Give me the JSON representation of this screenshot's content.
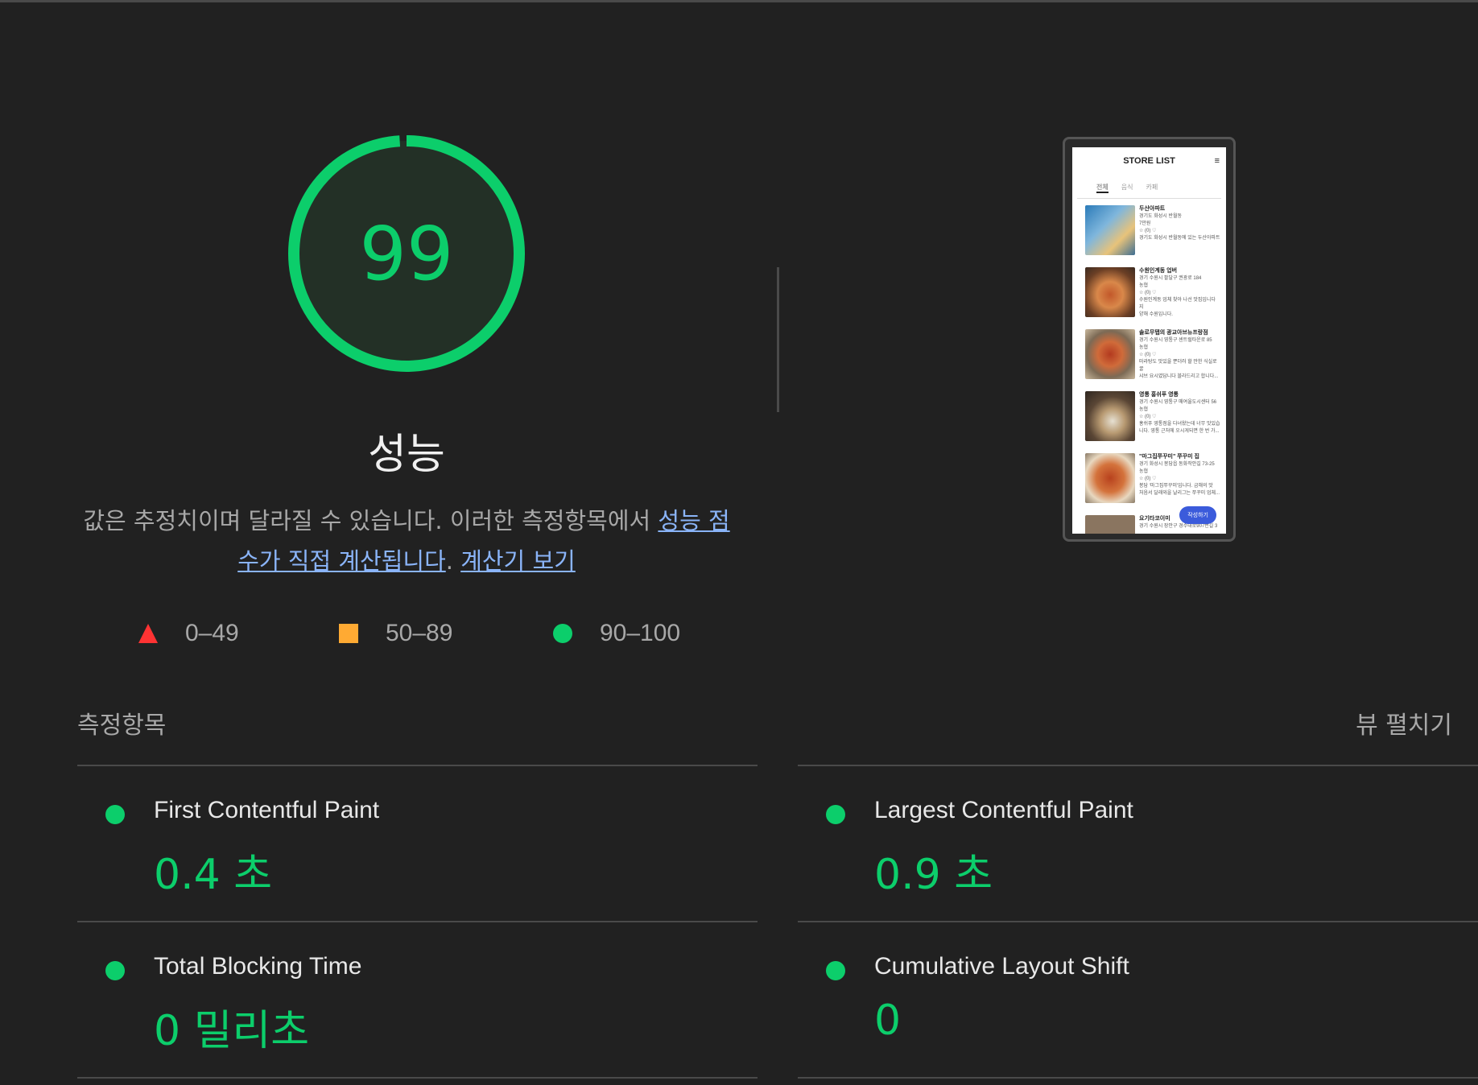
{
  "gauge": {
    "score": "99",
    "score_fraction": 0.99,
    "title": "성능",
    "color": "#0cce6b"
  },
  "description": {
    "text_before": "값은 추정치이며 달라질 수 있습니다. 이러한 측정항목에서 ",
    "link1": "성능 점수가 직접 계산됩니다",
    "separator": ". ",
    "link2": "계산기 보기"
  },
  "legend": [
    {
      "range": "0–49",
      "shape": "triangle",
      "color": "#ff3333"
    },
    {
      "range": "50–89",
      "shape": "square",
      "color": "#ffaa33"
    },
    {
      "range": "90–100",
      "shape": "circle",
      "color": "#0cce6b"
    }
  ],
  "screenshot": {
    "header": "STORE LIST",
    "tabs": [
      "전체",
      "음식",
      "카페"
    ],
    "items": [
      {
        "name": "두산아파트",
        "lines": [
          "경기도 화성시 반월동",
          "7만원",
          "☆ (0)  ♡",
          "경기도 화성시 반월동에 있는 두산아파트"
        ]
      },
      {
        "name": "수원인계동 업버",
        "lines": [
          "경기 수원시 팔달구 권광로 184",
          "농협",
          "☆ (0)  ♡",
          "수원인계동 업체 찾아 나선 맛집입니다 지",
          "양해 수원입니다."
        ]
      },
      {
        "name": "솔로무탭의 광교아브뉴프랑점",
        "lines": [
          "경기 수원시 영통구 센트럴타운로 85",
          "농협",
          "☆ (0)  ♡",
          "마라탕도 맛있을 뿐더러 할 만한 식실로 꿀",
          "샤브 요시였답니다 블라드리고 합니다..."
        ]
      },
      {
        "name": "영통 홍쉬푸 영통",
        "lines": [
          "경기 수원시 영통구 매여울도시센터 56",
          "농협",
          "☆ (0)  ♡",
          "홍쉬푸 영통점을 다녀왔는데 너무 맛있습",
          "니다. 영통 근처에 오시게되면 한 번 가..."
        ]
      },
      {
        "name": "\"마그집쭈꾸미\" 쭈꾸미 집",
        "lines": [
          "경기 화성시 봉담읍 동화작안길 73-25",
          "농협",
          "☆ (0)  ♡",
          "봉담 '마그집쭈꾸미'입니다. 금해의 맛",
          "처음서 달래와을 날리그는 쭈꾸미 업체..."
        ]
      },
      {
        "name": "요기타코이미",
        "lines": [
          "경기 수원시 장안구 경수대로907번길 3"
        ]
      }
    ],
    "fab": "작성하기",
    "menu_icon": "hamburger-icon"
  },
  "metrics": {
    "header": "측정항목",
    "expand_label": "뷰 펼치기",
    "items": [
      {
        "title": "First Contentful Paint",
        "value": "0.4 초",
        "status": "good"
      },
      {
        "title": "Largest Contentful Paint",
        "value": "0.9 초",
        "status": "good"
      },
      {
        "title": "Total Blocking Time",
        "value": "0 밀리초",
        "status": "good"
      },
      {
        "title": "Cumulative Layout Shift",
        "value": "0",
        "status": "good"
      }
    ]
  }
}
